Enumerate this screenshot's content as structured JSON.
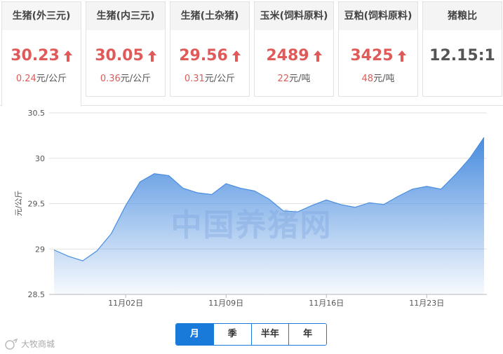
{
  "cards": [
    {
      "title": "生猪(外三元)",
      "price": "30.23",
      "arrow": "up",
      "change_num": "0.24",
      "change_unit": "元/公斤"
    },
    {
      "title": "生猪(内三元)",
      "price": "30.05",
      "arrow": "up",
      "change_num": "0.36",
      "change_unit": "元/公斤"
    },
    {
      "title": "生猪(土杂猪)",
      "price": "29.56",
      "arrow": "up",
      "change_num": "0.31",
      "change_unit": "元/公斤"
    },
    {
      "title": "玉米(饲料原料)",
      "price": "2489",
      "arrow": "up",
      "change_num": "22",
      "change_unit": "元/吨"
    },
    {
      "title": "豆粕(饲料原料)",
      "price": "3425",
      "arrow": "up",
      "change_num": "48",
      "change_unit": "元/吨"
    },
    {
      "title": "猪粮比",
      "price": "12.15:1",
      "arrow": "none",
      "change_num": "",
      "change_unit": ""
    }
  ],
  "chart_data": {
    "type": "area",
    "title": "",
    "ylabel": "元/公斤",
    "xlabel": "",
    "ylim": [
      28.5,
      30.5
    ],
    "yticks": [
      "28.5",
      "29",
      "29.5",
      "30",
      "30.5"
    ],
    "x_tick_labels": [
      {
        "index": 5,
        "label": "11月02日"
      },
      {
        "index": 12,
        "label": "11月09日"
      },
      {
        "index": 19,
        "label": "11月16日"
      },
      {
        "index": 26,
        "label": "11月23日"
      }
    ],
    "x": [
      "10-28",
      "10-29",
      "10-30",
      "10-31",
      "11-01",
      "11-02",
      "11-03",
      "11-04",
      "11-05",
      "11-06",
      "11-07",
      "11-08",
      "11-09",
      "11-10",
      "11-11",
      "11-12",
      "11-13",
      "11-14",
      "11-15",
      "11-16",
      "11-17",
      "11-18",
      "11-19",
      "11-20",
      "11-21",
      "11-22",
      "11-23",
      "11-24",
      "11-25",
      "11-26",
      "11-27"
    ],
    "series": [
      {
        "values": [
          28.99,
          28.92,
          28.87,
          28.98,
          29.17,
          29.48,
          29.74,
          29.83,
          29.81,
          29.67,
          29.62,
          29.6,
          29.72,
          29.67,
          29.64,
          29.55,
          29.42,
          29.41,
          29.48,
          29.54,
          29.49,
          29.46,
          29.51,
          29.49,
          29.58,
          29.66,
          29.69,
          29.66,
          29.82,
          30.0,
          30.23
        ]
      }
    ],
    "grid": true,
    "color": "#4a8ee0"
  },
  "watermark": "中国养猪网",
  "period_buttons": [
    "月",
    "季",
    "半年",
    "年"
  ],
  "active_period": "月",
  "logo_text": "大牧商城"
}
